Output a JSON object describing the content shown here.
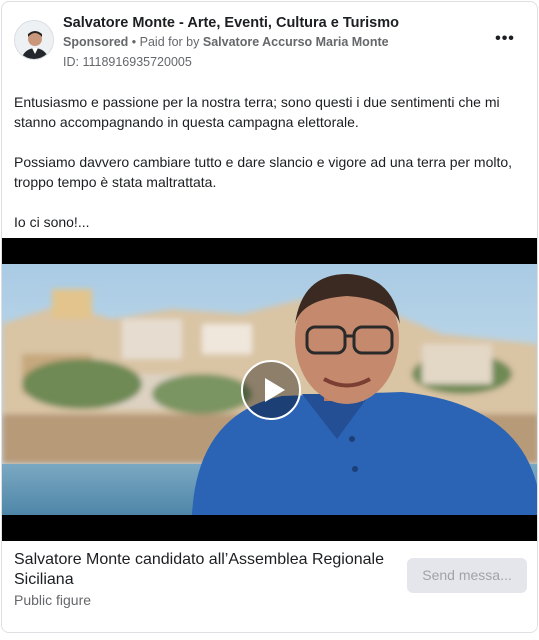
{
  "ad": {
    "page_name": "Salvatore Monte - Arte, Eventi, Cultura e Turismo",
    "sponsored_label": "Sponsored",
    "separator": " • ",
    "paid_for_by_label": "Paid for by ",
    "paid_for_by_name": "Salvatore Accurso Maria Monte",
    "id_text": "ID: 1118916935720005",
    "more_options_label": "•••"
  },
  "body": {
    "paragraphs": [
      "Entusiasmo e passione per la nostra terra; sono questi i due sentimenti che mi stanno accompagnando in questa campagna elettorale.",
      "Possiamo davvero cambiare tutto e dare slancio e vigore ad una terra per molto, troppo tempo è stata maltrattata.",
      "Io ci sono!..."
    ]
  },
  "cta": {
    "title": "Salvatore Monte candidato all’Assemblea Regionale Siciliana",
    "subtitle": "Public figure",
    "button_label": "Send messa..."
  },
  "icons": {
    "play": "play-icon",
    "more": "more-options-icon"
  },
  "colors": {
    "shirt": "#2a62b8",
    "sky": "#b9d6ea",
    "sea": "#6c9fbd",
    "muted_text": "#65676b",
    "button_bg": "#e4e6eb"
  }
}
